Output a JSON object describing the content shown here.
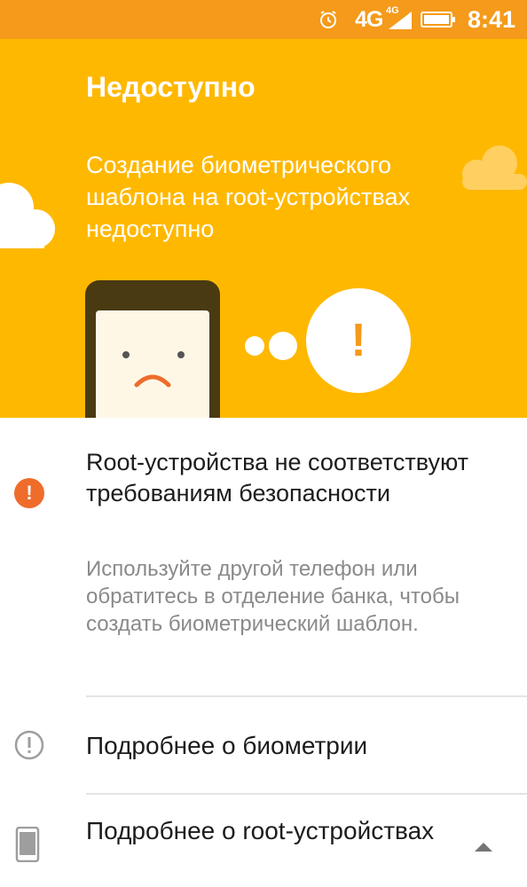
{
  "status_bar": {
    "alarm_icon": "alarm-icon",
    "network": "4G",
    "network_small": "4G",
    "signal_icon": "signal-icon",
    "battery_icon": "battery-icon",
    "time": "8:41"
  },
  "banner": {
    "title": "Недоступно",
    "subtitle": "Создание биометрического шаблона на root-устройствах недоступно",
    "exclamation": "!",
    "background_color": "#ffb800"
  },
  "warning": {
    "icon": "exclamation-circle-icon",
    "icon_glyph": "!",
    "title": "Root-устройства не соответствуют требованиям безопасности",
    "description": "Используйте другой телефон или обратитесь в отделение банка, чтобы создать биометрический шаблон."
  },
  "links": [
    {
      "icon": "info-circle-icon",
      "label": "Подробнее о биометрии"
    },
    {
      "icon": "phone-icon",
      "label": "Подробнее о root-устройствах",
      "chevron": "chevron-up-icon"
    }
  ],
  "colors": {
    "status_bar": "#f59a1a",
    "accent": "#ef6c2b",
    "text_secondary": "#8a8a8a"
  }
}
